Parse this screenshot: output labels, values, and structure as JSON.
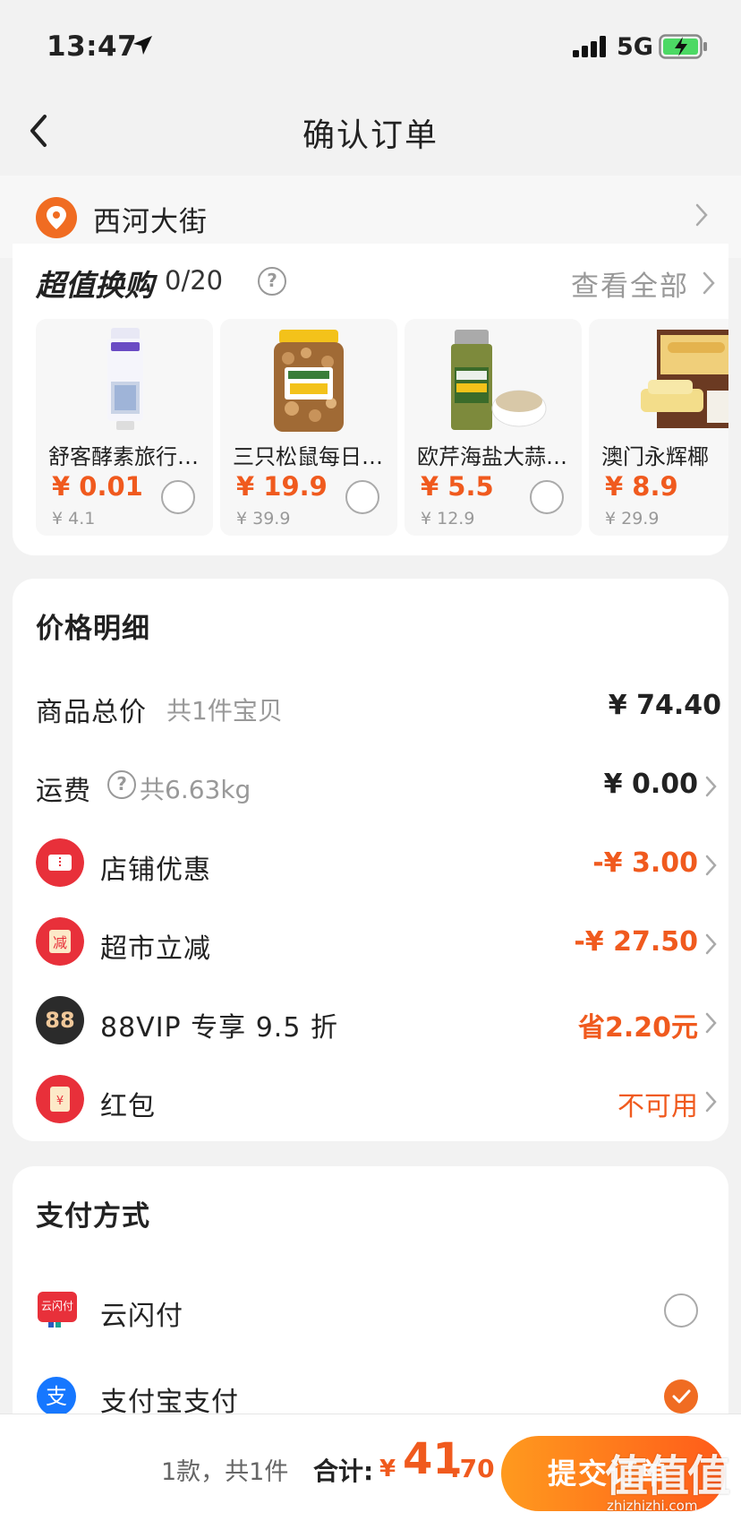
{
  "status_bar": {
    "time": "13:47",
    "network": "5G"
  },
  "nav": {
    "title": "确认订单"
  },
  "address": {
    "text": "西河大街"
  },
  "exchange": {
    "title": "超值换购",
    "count": "0/20",
    "view_all": "查看全部",
    "products": [
      {
        "name": "舒客酵素旅行…",
        "price": "¥ 0.01",
        "original": "¥ 4.1"
      },
      {
        "name": "三只松鼠每日…",
        "price": "¥ 19.9",
        "original": "¥ 39.9"
      },
      {
        "name": "欧芹海盐大蒜…",
        "price": "¥ 5.5",
        "original": "¥ 12.9"
      },
      {
        "name": "澳门永辉椰",
        "price": "¥ 8.9",
        "original": "¥ 29.9"
      }
    ]
  },
  "price_detail": {
    "title": "价格明细",
    "goods_total": {
      "label": "商品总价",
      "sub": "共1件宝贝",
      "value": "¥ 74.40"
    },
    "shipping": {
      "label": "运费",
      "sub": "共6.63kg",
      "value": "¥ 0.00"
    },
    "store_discount": {
      "label": "店铺优惠",
      "value": "-¥ 3.00"
    },
    "market_reduce": {
      "label": "超市立减",
      "value": "-¥ 27.50"
    },
    "vip": {
      "label": "88VIP 专享 9.5 折",
      "value": "省2.20元",
      "icon_text": "88"
    },
    "red_packet": {
      "label": "红包",
      "value": "不可用"
    }
  },
  "payment": {
    "title": "支付方式",
    "methods": [
      {
        "label": "云闪付",
        "selected": false
      },
      {
        "label": "支付宝支付",
        "selected": true
      }
    ]
  },
  "bottom": {
    "summary": "1款，共1件",
    "total_label": "合计:",
    "currency": "¥",
    "total_int": "41",
    "total_dec": ".70",
    "submit": "提交订单"
  },
  "watermark": {
    "big": "值值值",
    "small": "zhizhizhi.com"
  },
  "colors": {
    "accent": "#f05a1e",
    "orange_button_start": "#ff9a1e",
    "orange_button_end": "#ff5b1a"
  }
}
